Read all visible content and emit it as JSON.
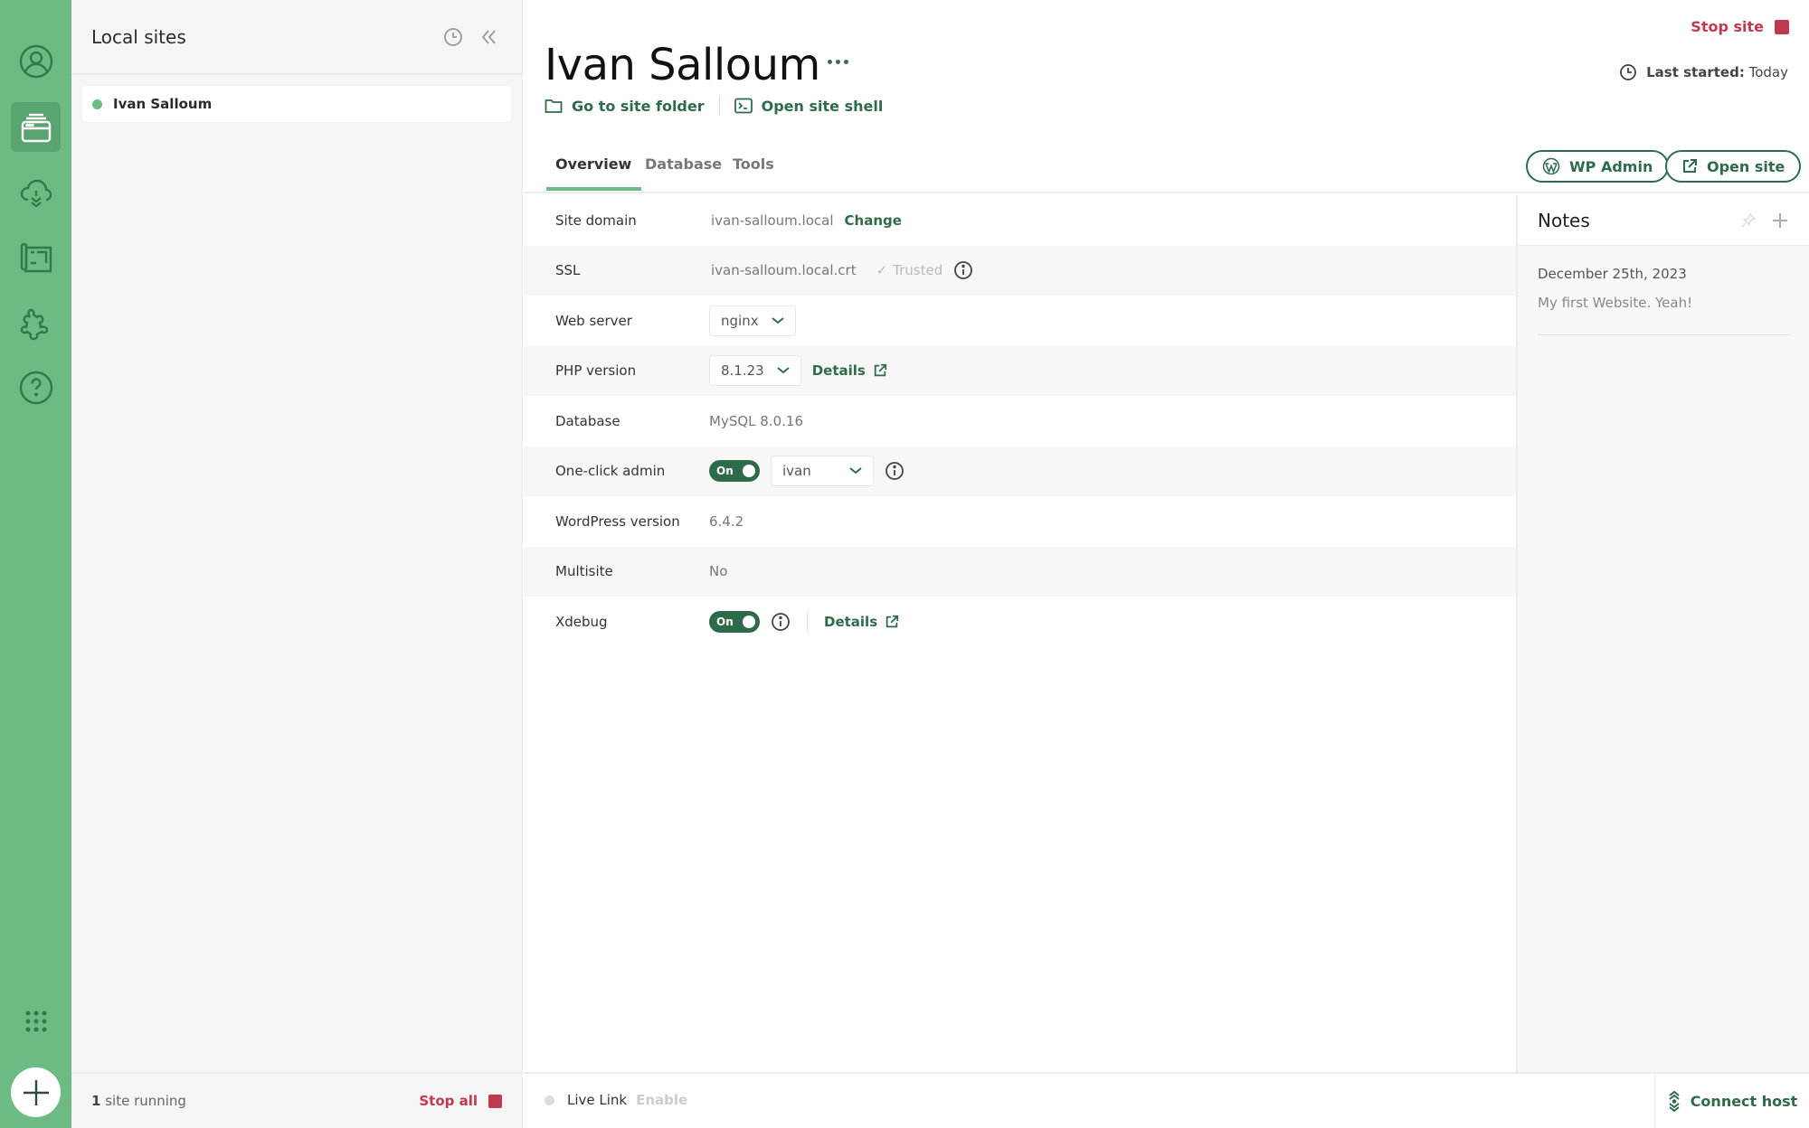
{
  "colors": {
    "brand_green": "#6dbb83",
    "dark_green": "#2e6b4a",
    "stop_red": "#c0394f"
  },
  "rail": {
    "items": [
      {
        "icon": "user-account-icon",
        "active": false
      },
      {
        "icon": "local-sites-icon",
        "active": true
      },
      {
        "icon": "cloud-sync-icon",
        "active": false
      },
      {
        "icon": "blueprints-icon",
        "active": false
      },
      {
        "icon": "addons-puzzle-icon",
        "active": false
      },
      {
        "icon": "help-icon",
        "active": false
      }
    ],
    "apps_icon": "grid-dots-icon",
    "add_icon": "plus-icon"
  },
  "sites_panel": {
    "title": "Local sites",
    "sites": [
      {
        "name": "Ivan Salloum",
        "status": "running"
      }
    ],
    "footer": {
      "count": "1",
      "running_text": " site running",
      "stop_all": "Stop all"
    }
  },
  "site": {
    "title": "Ivan Salloum",
    "go_to_folder": "Go to site folder",
    "open_shell": "Open site shell",
    "stop_site": "Stop site",
    "last_started_label": "Last started:",
    "last_started_value": "Today",
    "tabs": [
      "Overview",
      "Database",
      "Tools"
    ],
    "active_tab": "Overview",
    "wp_admin": "WP Admin",
    "open_site": "Open site"
  },
  "overview": {
    "site_domain": {
      "label": "Site domain",
      "value": "ivan-salloum.local",
      "action": "Change"
    },
    "ssl": {
      "label": "SSL",
      "value": "ivan-salloum.local.crt",
      "status": "Trusted"
    },
    "web_server": {
      "label": "Web server",
      "value": "nginx"
    },
    "php_version": {
      "label": "PHP version",
      "value": "8.1.23",
      "details": "Details"
    },
    "database": {
      "label": "Database",
      "value": "MySQL 8.0.16"
    },
    "one_click_admin": {
      "label": "One-click admin",
      "toggle": "On",
      "user": "ivan"
    },
    "wordpress_version": {
      "label": "WordPress version",
      "value": "6.4.2"
    },
    "multisite": {
      "label": "Multisite",
      "value": "No"
    },
    "xdebug": {
      "label": "Xdebug",
      "toggle": "On",
      "details": "Details"
    }
  },
  "notes": {
    "title": "Notes",
    "items": [
      {
        "date": "December 25th, 2023",
        "text": "My first Website. Yeah!"
      }
    ]
  },
  "bottom_bar": {
    "live_link": "Live Link",
    "enable": "Enable",
    "connect_host": "Connect host"
  }
}
